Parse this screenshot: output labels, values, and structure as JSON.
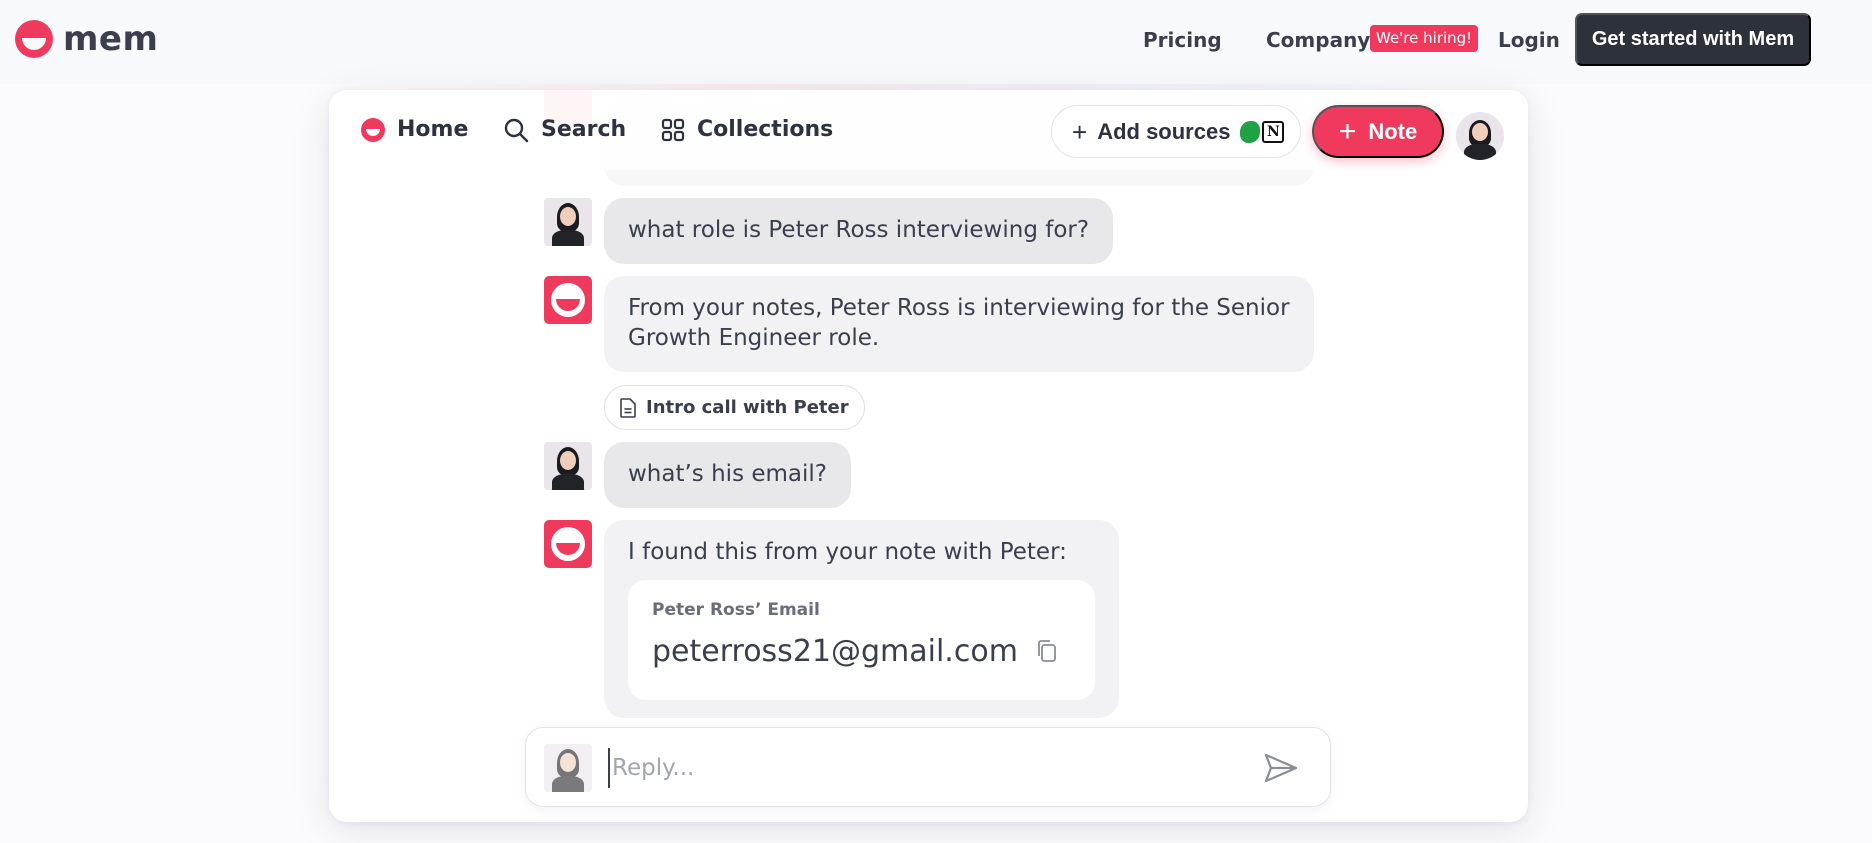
{
  "site_header": {
    "logo_text": "mem",
    "nav": {
      "pricing": "Pricing",
      "company": "Company",
      "hiring_badge": "We're hiring!",
      "login": "Login"
    },
    "cta_label": "Get started with Mem"
  },
  "app_toolbar": {
    "home_label": "Home",
    "search_label": "Search",
    "collections_label": "Collections",
    "add_sources_label": "Add sources",
    "note_label": "Note"
  },
  "conversation": {
    "messages": [
      {
        "role": "user",
        "text": "what role is Peter Ross interviewing for?"
      },
      {
        "role": "assistant",
        "text": "From your notes, Peter Ross is interviewing for the Senior Growth Engineer role.",
        "source": "Intro call with Peter"
      },
      {
        "role": "user",
        "text": "what’s his email?"
      },
      {
        "role": "assistant",
        "text": "I found this from your note with Peter:",
        "card": {
          "label": "Peter Ross’ Email",
          "value": "peterross21@gmail.com"
        }
      }
    ]
  },
  "reply": {
    "placeholder": "Reply..."
  },
  "colors": {
    "brand": "#ef3a5d",
    "cta_background": "#2d3139",
    "bubble_user": "#e8e8eb",
    "bubble_assistant": "#f2f2f4"
  },
  "icons": [
    "mem-logo-icon",
    "home-icon",
    "search-icon",
    "collections-grid-icon",
    "plus-icon",
    "evernote-icon",
    "notion-icon",
    "document-icon",
    "copy-icon",
    "send-icon"
  ]
}
